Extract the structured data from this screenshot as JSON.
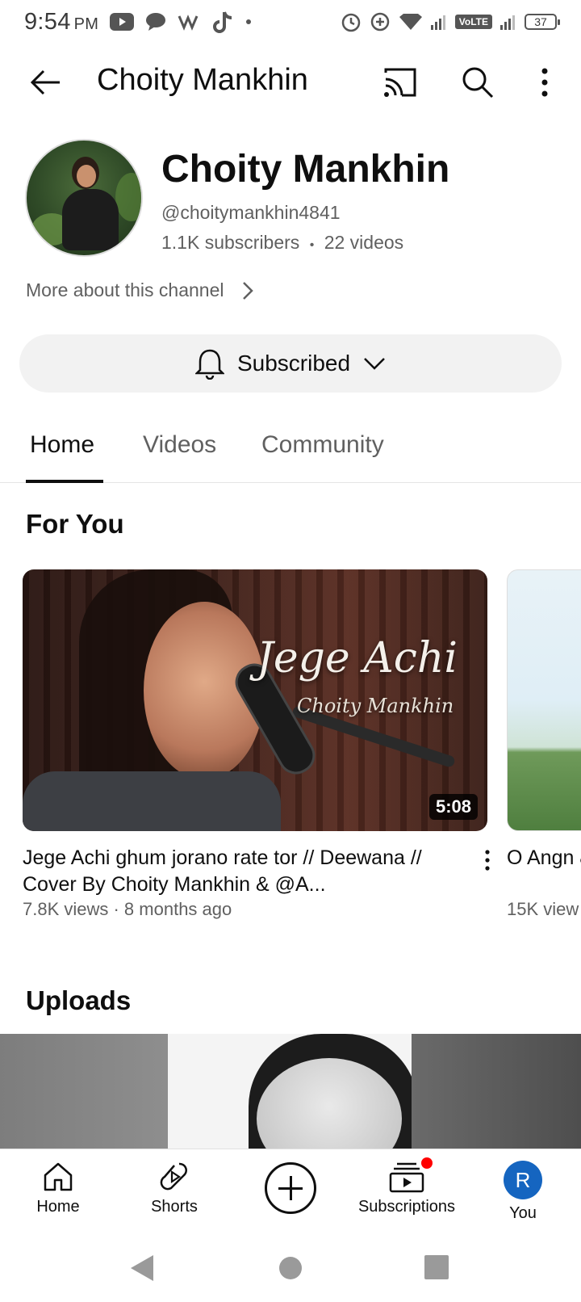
{
  "status_bar": {
    "time": "9:54",
    "ampm": "PM",
    "network_badge": "VoLTE",
    "battery": "37"
  },
  "app_bar": {
    "title": "Choity Mankhin",
    "icons": [
      "back-arrow-icon",
      "cast-icon",
      "search-icon",
      "more-vert-icon"
    ]
  },
  "channel": {
    "name": "Choity Mankhin",
    "handle": "@choitymankhin4841",
    "subscribers": "1.1K subscribers",
    "separator": "•",
    "videos": "22 videos",
    "more_about": "More about this channel",
    "subscribe_state": "Subscribed"
  },
  "tabs": [
    {
      "label": "Home",
      "active": true
    },
    {
      "label": "Videos",
      "active": false
    },
    {
      "label": "Community",
      "active": false
    }
  ],
  "sections": {
    "for_you": "For You",
    "uploads": "Uploads"
  },
  "for_you_videos": [
    {
      "thumb_title": "Jege Achi",
      "thumb_subtitle": "Choity Mankhin",
      "duration": "5:08",
      "title": "Jege Achi ghum jorano rate tor // Deewana // Cover By Choity Mankhin & @A...",
      "meta": "7.8K views · 8 months ago"
    },
    {
      "title": "O Angn &Jemi I",
      "meta": "15K view"
    }
  ],
  "bottom_nav": [
    {
      "label": "Home",
      "icon": "home-icon"
    },
    {
      "label": "Shorts",
      "icon": "shorts-icon"
    },
    {
      "label": "",
      "icon": "create-icon"
    },
    {
      "label": "Subscriptions",
      "icon": "subscriptions-icon"
    },
    {
      "label": "You",
      "icon": "avatar",
      "avatar_letter": "R"
    }
  ],
  "colors": {
    "accent_red": "#ff0000",
    "avatar_blue": "#1565c0",
    "pill_bg": "#f2f2f2"
  }
}
